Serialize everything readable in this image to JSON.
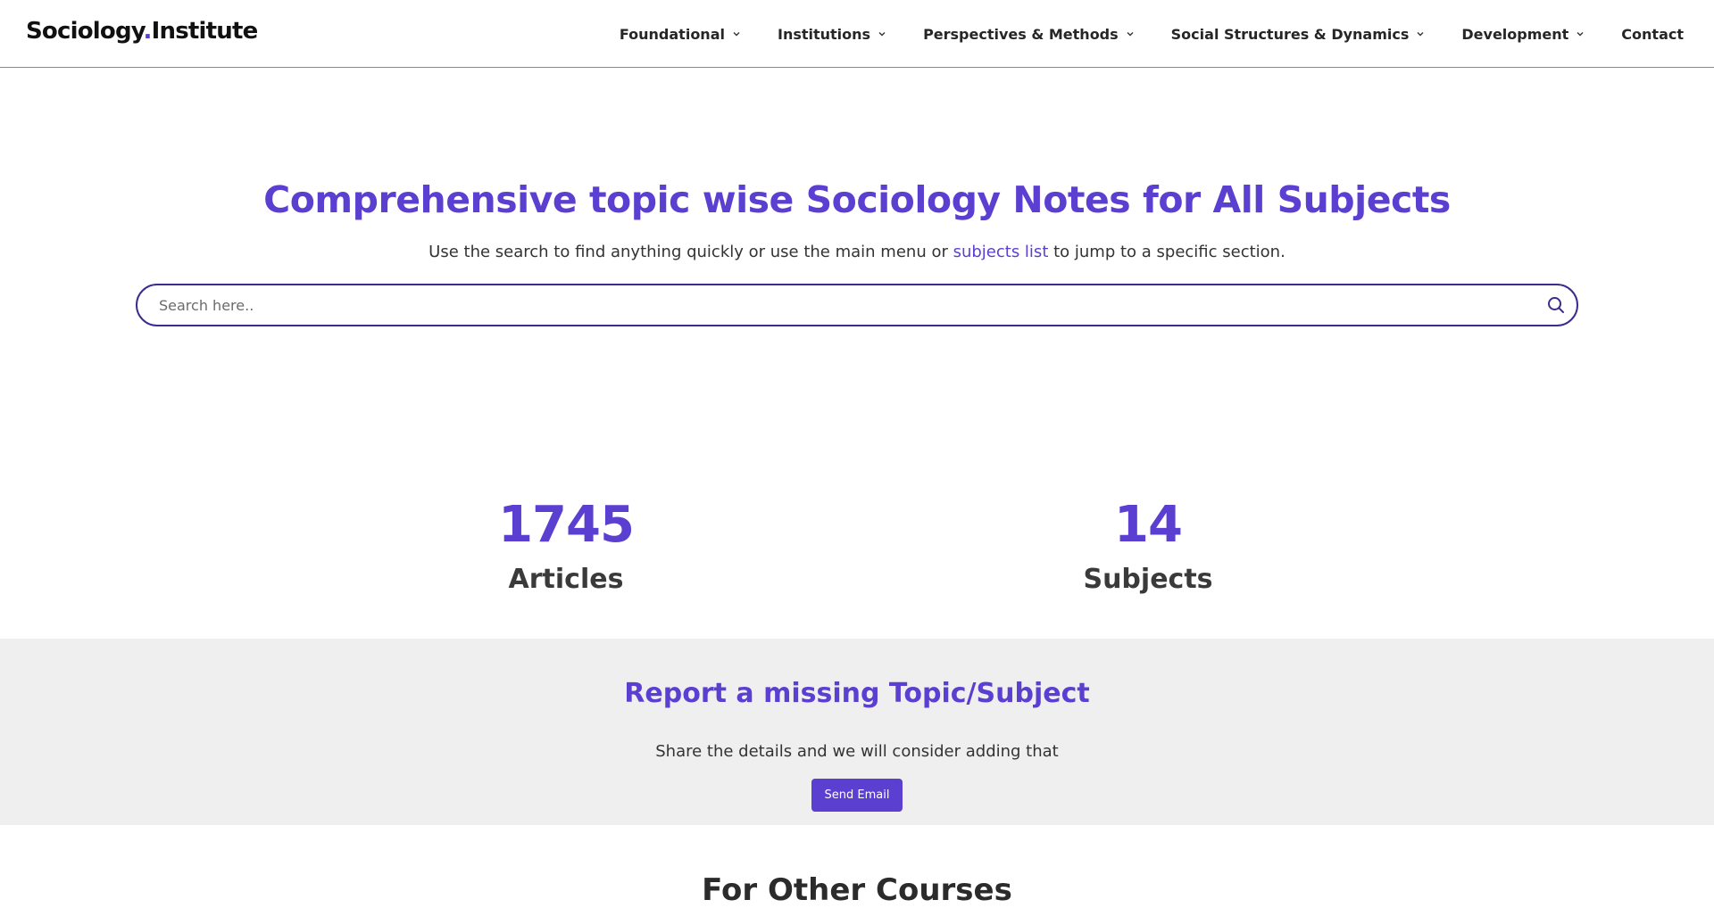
{
  "header": {
    "logo": {
      "part1": "Sociology",
      "dot": ".",
      "part2": "Institute"
    },
    "nav": [
      {
        "label": "Foundational",
        "has_dropdown": true
      },
      {
        "label": "Institutions",
        "has_dropdown": true
      },
      {
        "label": "Perspectives & Methods",
        "has_dropdown": true
      },
      {
        "label": "Social Structures & Dynamics",
        "has_dropdown": true
      },
      {
        "label": "Development",
        "has_dropdown": true
      },
      {
        "label": "Contact",
        "has_dropdown": false
      }
    ]
  },
  "hero": {
    "title": "Comprehensive topic wise Sociology Notes for All Subjects",
    "subtitle_before": "Use the search to find anything quickly or use the main menu or ",
    "subtitle_link": "subjects list",
    "subtitle_after": " to jump to a specific section.",
    "search": {
      "placeholder": "Search here..",
      "value": ""
    }
  },
  "stats": [
    {
      "number": "1745",
      "label": "Articles"
    },
    {
      "number": "14",
      "label": "Subjects"
    }
  ],
  "report": {
    "title": "Report a missing Topic/Subject",
    "text": "Share the details and we will consider adding that",
    "button_label": "Send Email"
  },
  "next_section": {
    "heading": "For Other Courses"
  },
  "colors": {
    "accent": "#5b3fd0",
    "search_border": "#3d2b8f",
    "report_bg": "#efefef",
    "text": "#2b2b2b"
  },
  "icons": {
    "dropdown": "chevron-down-icon",
    "search": "search-icon"
  }
}
